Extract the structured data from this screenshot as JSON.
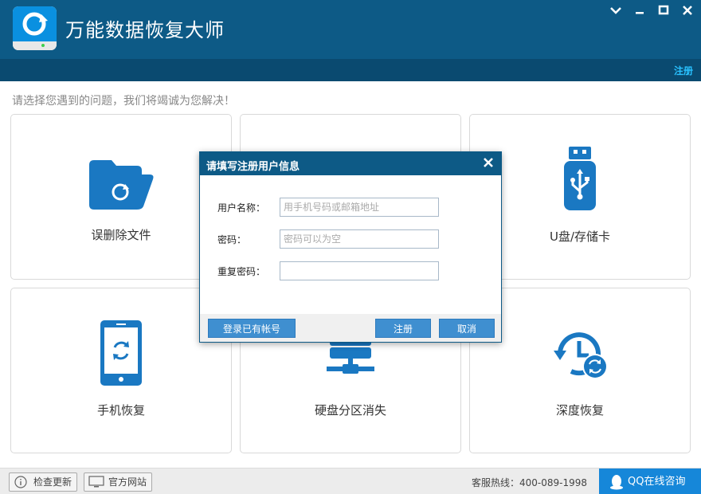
{
  "app": {
    "title": "万能数据恢复大师"
  },
  "header": {
    "register_link": "注册"
  },
  "main": {
    "prompt": "请选择您遇到的问题，我们将竭诚为您解决！",
    "cards": [
      {
        "label": "误删除文件",
        "icon": "folder-restore-icon"
      },
      {
        "label": "",
        "icon": "hidden-card"
      },
      {
        "label": "U盘/存储卡",
        "icon": "usb-drive-icon"
      },
      {
        "label": "手机恢复",
        "icon": "phone-restore-icon"
      },
      {
        "label": "硬盘分区消失",
        "icon": "hard-disk-icon"
      },
      {
        "label": "深度恢复",
        "icon": "deep-recovery-icon"
      }
    ]
  },
  "footer": {
    "check_update": "检查更新",
    "official_site": "官方网站",
    "hotline": "客服热线：400-089-1998",
    "qq_consult": "QQ在线咨询"
  },
  "dialog": {
    "title": "请填写注册用户信息",
    "username_label": "用户名称：",
    "username_placeholder": "用手机号码或邮箱地址",
    "password_label": "密码：",
    "password_placeholder": "密码可以为空",
    "repeat_password_label": "重复密码：",
    "login_existing": "登录已有帐号",
    "register": "注册",
    "cancel": "取消"
  },
  "colors": {
    "header_bg": "#0d5a86",
    "accent": "#1a78c2",
    "button": "#3f8fd0"
  }
}
